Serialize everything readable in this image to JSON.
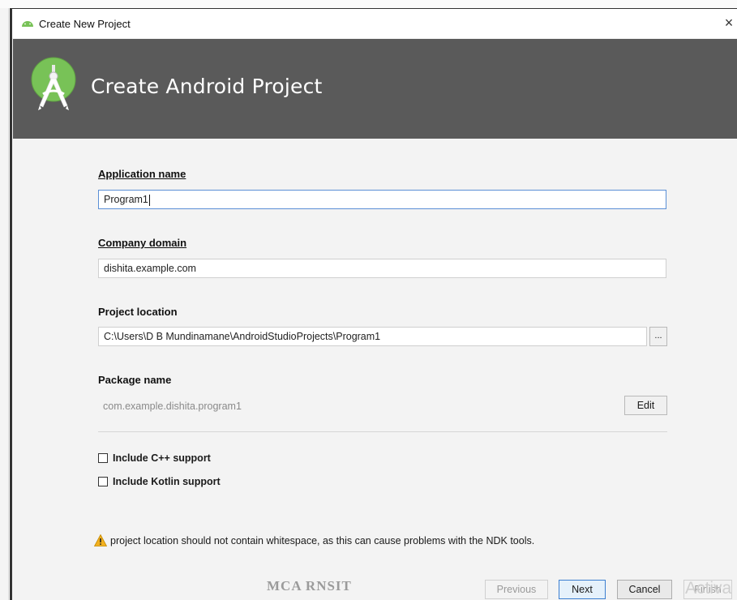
{
  "window": {
    "title": "Create New Project",
    "close_glyph": "×"
  },
  "banner": {
    "title": "Create Android Project",
    "logo_icon": "android-studio-logo",
    "bg_color": "#5a5a5a",
    "accent_color": "#78c257"
  },
  "form": {
    "app_name_label": "Application name",
    "app_name_value": "Program1",
    "company_domain_label": "Company domain",
    "company_domain_value": "dishita.example.com",
    "project_location_label": "Project location",
    "project_location_value": "C:\\Users\\D B Mundinamane\\AndroidStudioProjects\\Program1",
    "browse_label": "...",
    "package_name_label": "Package name",
    "package_name_value": "com.example.dishita.program1",
    "edit_label": "Edit",
    "cpp_support_label": "Include C++ support",
    "cpp_support_checked": false,
    "kotlin_support_label": "Include Kotlin support",
    "kotlin_support_checked": false
  },
  "warning": {
    "icon": "warning-icon",
    "text": "project location should not contain whitespace, as this can cause problems with the NDK tools."
  },
  "footer": {
    "watermark": "MCA RNSIT",
    "previous_label": "Previous",
    "next_label": "Next",
    "cancel_label": "Cancel",
    "finish_label": "Finish",
    "activate_text": "Activa"
  }
}
